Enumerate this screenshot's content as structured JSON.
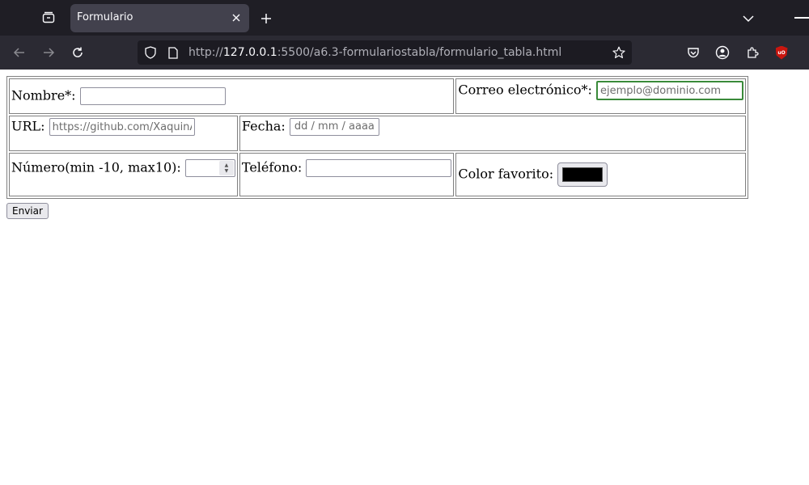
{
  "browser": {
    "tab_title": "Formulario",
    "url_scheme": "http://",
    "url_host": "127.0.0.1",
    "url_rest": ":5500/a6.3-formulariostabla/formulario_tabla.html",
    "icons": [
      "tab-list-icon",
      "close-icon",
      "plus-icon",
      "chevron-down-icon",
      "back-arrow-icon",
      "forward-arrow-icon",
      "reload-icon",
      "shield-icon",
      "page-icon",
      "star-icon",
      "pocket-icon",
      "account-icon",
      "extensions-icon",
      "ublock-icon"
    ],
    "ublock_label": "uO"
  },
  "form": {
    "nombre_label": "Nombre*:",
    "correo_label": "Correo electrónico*:",
    "correo_placeholder": "ejemplo@dominio.com",
    "url_label": "URL:",
    "url_placeholder": "https://github.com/XaquinAl",
    "fecha_label": "Fecha:",
    "fecha_placeholder": "dd / mm / aaaa",
    "numero_label": "Número(min -10, max10):",
    "telefono_label": "Teléfono:",
    "color_label": "Color favorito:",
    "color_value": "#000000",
    "submit_label": "Enviar"
  }
}
